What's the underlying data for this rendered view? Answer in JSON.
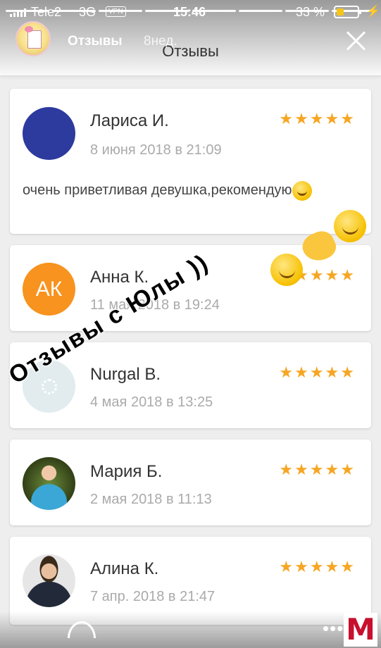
{
  "status_bar": {
    "carrier": "Tele2",
    "network": "3G",
    "vpn_label": "VPN",
    "time": "15:46",
    "battery_percent": "33 %",
    "battery_level": 0.33,
    "icons": [
      "signal-icon",
      "battery-icon",
      "charging-icon"
    ]
  },
  "story": {
    "username": "Отзывы",
    "age": "8нед.",
    "progress_segments_total": 8,
    "progress_segments_done": 8
  },
  "app": {
    "title": "Отзывы"
  },
  "reviews": [
    {
      "name": "Лариса И.",
      "date": "8 июня 2018 в 21:09",
      "stars": "★★★★★",
      "rating": 5,
      "text": "очень приветливая девушка,рекомендую",
      "avatar_color": "#2d3a9e"
    },
    {
      "name": "Анна К.",
      "date": "11 мая 2018 в 19:24",
      "stars": "★★★★★",
      "rating": 5,
      "initials": "АК",
      "avatar_color": "#f7931e"
    },
    {
      "name": "Nurgal B.",
      "date": "4 мая 2018 в 13:25",
      "stars": "★★★★★",
      "rating": 5,
      "avatar_color": "#e2ecef"
    },
    {
      "name": "Мария Б.",
      "date": "2 мая 2018 в 11:13",
      "stars": "★★★★★",
      "rating": 5
    },
    {
      "name": "Алина К.",
      "date": "7 апр. 2018 в 21:47",
      "stars": "★★★★★",
      "rating": 5
    }
  ],
  "overlay": {
    "caption": "Отзывы с Юлы ))"
  },
  "colors": {
    "star": "#f6a623",
    "background": "#eeeeee",
    "card": "#ffffff",
    "logo": "#c8102e"
  },
  "watermark": {
    "letter": "M"
  }
}
